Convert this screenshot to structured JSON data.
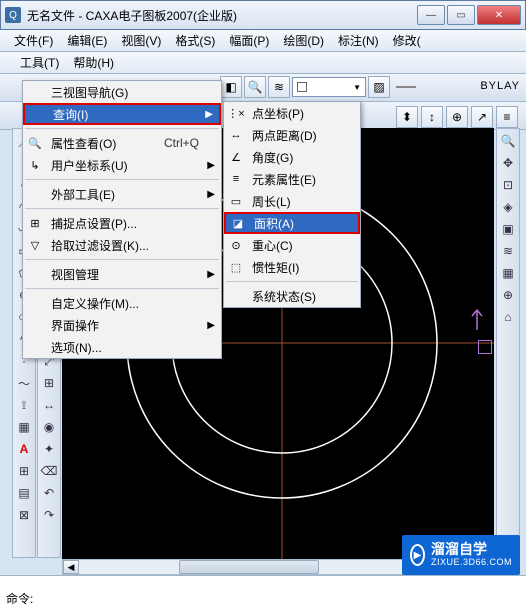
{
  "window": {
    "title": "无名文件 - CAXA电子图板2007(企业版)",
    "min_tooltip": "Minimize",
    "max_tooltip": "Maximize",
    "close_tooltip": "Close"
  },
  "menubar": {
    "file": "文件(F)",
    "edit": "编辑(E)",
    "view": "视图(V)",
    "format": "格式(S)",
    "paper": "幅面(P)",
    "draw": "绘图(D)",
    "annot": "标注(N)",
    "modify": "修改(",
    "tools": "工具(T)",
    "help": "帮助(H)"
  },
  "toolbar": {
    "layer_label": "",
    "bylayer": "BYLAY"
  },
  "tools_menu": {
    "items": [
      {
        "label": "三视图导航(G)",
        "icon": "",
        "arrow": false
      },
      {
        "label": "查询(I)",
        "icon": "",
        "arrow": true,
        "highlight": true,
        "redbox": true
      },
      {
        "label": "属性查看(O)",
        "icon": "🔍",
        "shortcut": "Ctrl+Q",
        "arrow": false
      },
      {
        "label": "用户坐标系(U)",
        "icon": "↳",
        "arrow": true
      },
      {
        "label": "外部工具(E)",
        "icon": "",
        "arrow": true
      },
      {
        "label": "捕捉点设置(P)...",
        "icon": "⊞",
        "arrow": false
      },
      {
        "label": "拾取过滤设置(K)...",
        "icon": "▽",
        "arrow": false
      },
      {
        "label": "视图管理",
        "icon": "",
        "arrow": true
      },
      {
        "label": "自定义操作(M)...",
        "icon": "",
        "arrow": false
      },
      {
        "label": "界面操作",
        "icon": "",
        "arrow": true
      },
      {
        "label": "选项(N)...",
        "icon": "",
        "arrow": false
      }
    ]
  },
  "query_submenu": {
    "items": [
      {
        "label": "点坐标(P)",
        "icon": "⋮×"
      },
      {
        "label": "两点距离(D)",
        "icon": "↔"
      },
      {
        "label": "角度(G)",
        "icon": "∠"
      },
      {
        "label": "元素属性(E)",
        "icon": "≡"
      },
      {
        "label": "周长(L)",
        "icon": "▭"
      },
      {
        "label": "面积(A)",
        "icon": "◪",
        "highlight": true,
        "redbox": true
      },
      {
        "label": "重心(C)",
        "icon": "⊙"
      },
      {
        "label": "惯性矩(I)",
        "icon": "⬚"
      },
      {
        "label": "系统状态(S)",
        "icon": ""
      }
    ]
  },
  "command": {
    "prompt": "命令:"
  },
  "watermark": {
    "brand": "溜溜自学",
    "url": "ZIXUE.3D66.COM"
  }
}
